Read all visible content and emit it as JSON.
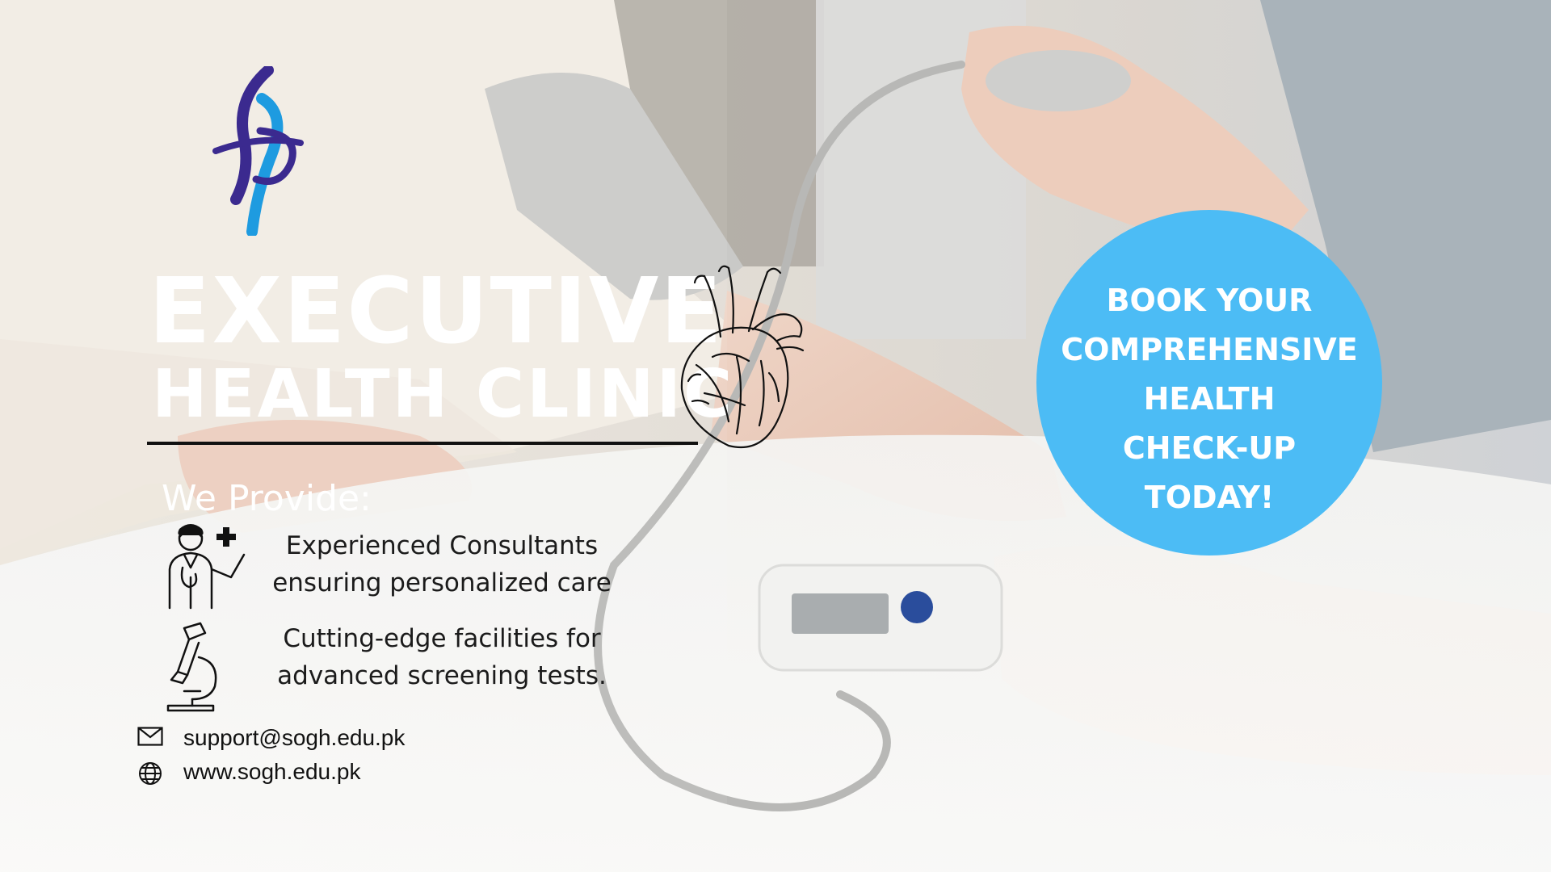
{
  "colors": {
    "cta_background": "#4cbcf5",
    "title_text": "#ffffff",
    "body_text": "#1b1b1b",
    "divider": "#111111",
    "logo_blue_dark": "#3b2a8f",
    "logo_blue_light": "#1e9be0"
  },
  "logo": {
    "icon": "hospital-logo-icon"
  },
  "title": {
    "line1": "EXECUTIVE",
    "line2": "HEALTH CLINIC"
  },
  "heart": {
    "icon": "anatomical-heart-icon"
  },
  "provide": {
    "heading": "We Provide:",
    "items": [
      {
        "icon": "doctor-icon",
        "line1": "Experienced Consultants",
        "line2": "ensuring personalized care"
      },
      {
        "icon": "microscope-icon",
        "line1": "Cutting-edge facilities for",
        "line2": "advanced screening tests."
      }
    ]
  },
  "contact": {
    "email": {
      "icon": "mail-icon",
      "text": "support@sogh.edu.pk"
    },
    "website": {
      "icon": "globe-icon",
      "text": "www.sogh.edu.pk"
    }
  },
  "cta": {
    "lines": [
      "BOOK YOUR",
      "COMPREHENSIVE",
      "HEALTH",
      "CHECK-UP",
      "TODAY!"
    ]
  }
}
